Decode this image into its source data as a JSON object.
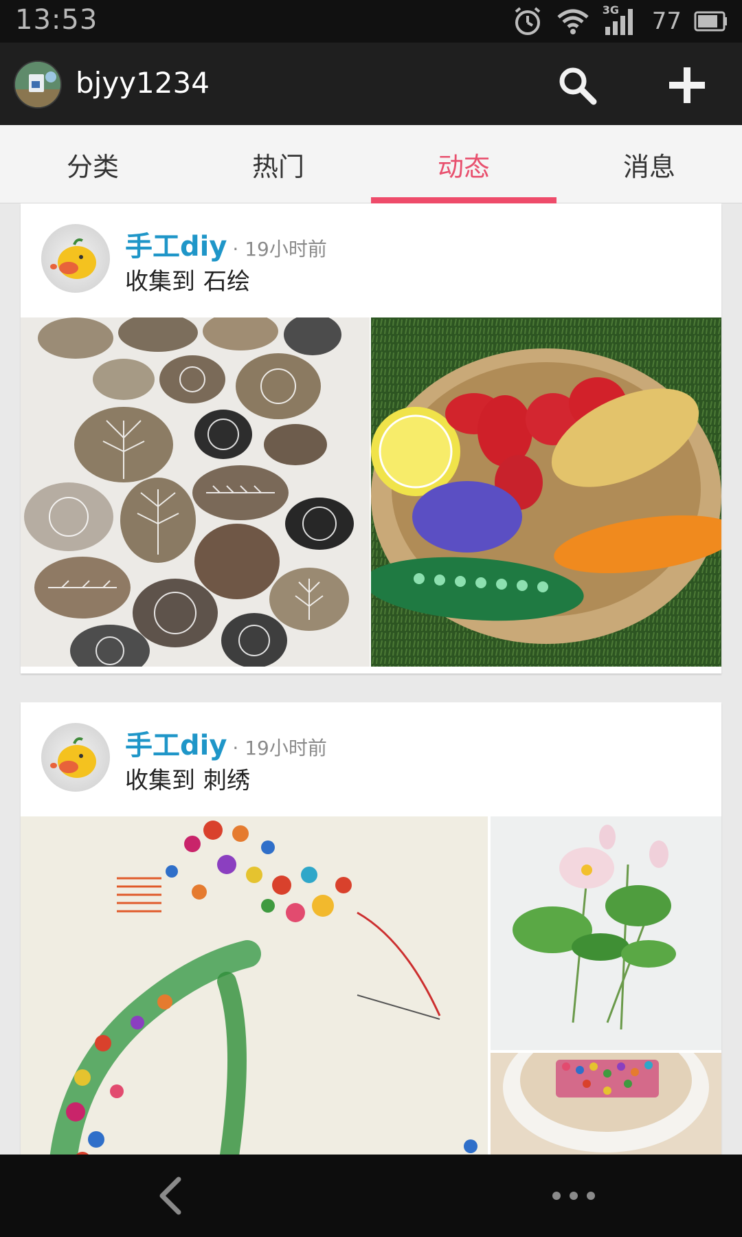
{
  "status_bar": {
    "time": "13:53",
    "network": "3G",
    "battery": "77",
    "icons": [
      "alarm-icon",
      "wifi-icon",
      "signal-icon",
      "battery-icon"
    ]
  },
  "header": {
    "username": "bjyy1234",
    "icons": [
      "search-icon",
      "plus-icon"
    ]
  },
  "tabs": [
    {
      "label": "分类",
      "active": false
    },
    {
      "label": "热门",
      "active": false
    },
    {
      "label": "动态",
      "active": true
    },
    {
      "label": "消息",
      "active": false
    }
  ],
  "feed": [
    {
      "user": "手工diy",
      "time": "· 19小时前",
      "action": "收集到",
      "board": "石绘"
    },
    {
      "user": "手工diy",
      "time": "· 19小时前",
      "action": "收集到",
      "board": "刺绣"
    }
  ],
  "colors": {
    "accent": "#ee4b6a",
    "user_link": "#1f96c8",
    "status_bar": "#111111",
    "title_bar": "#1f1f1f"
  },
  "nav": {
    "icons": [
      "back-icon",
      "more-icon"
    ]
  }
}
